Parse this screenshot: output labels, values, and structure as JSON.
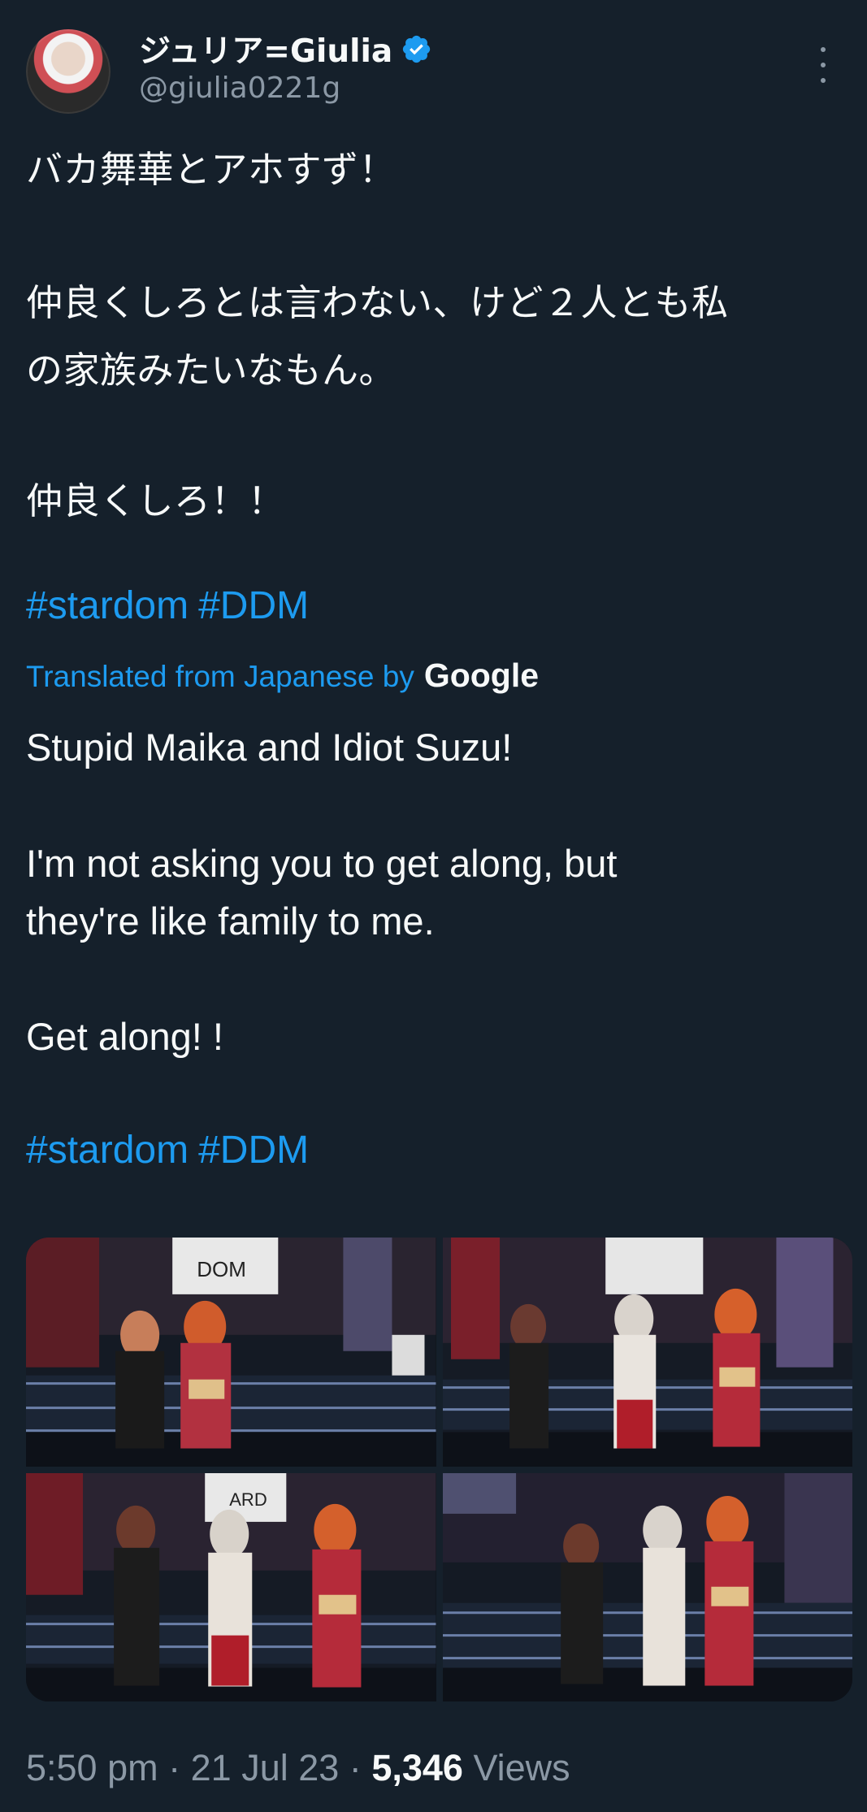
{
  "tweet": {
    "author": {
      "display_name": "ジュリア=Giulia",
      "handle": "@giulia0221g",
      "verified": true
    },
    "original_text": [
      "バカ舞華とアホすず！",
      "仲良くしろとは言わない、けど２人とも私",
      "の家族みたいなもん。",
      "仲良くしろ！！"
    ],
    "hashtags": [
      "#stardom",
      "#DDM"
    ],
    "translation": {
      "label": "Translated from Japanese by",
      "provider": "Google",
      "text": [
        "Stupid Maika and Idiot Suzu!",
        "I'm not asking you to get along, but",
        "they're like family to me.",
        "Get along! !"
      ]
    },
    "media": {
      "count": 4,
      "description": [
        "photo-1",
        "photo-2",
        "photo-3",
        "photo-4"
      ]
    },
    "meta": {
      "time": "5:50 pm",
      "date": "21 Jul 23",
      "separator": "·",
      "views_count": "5,346",
      "views_label": "Views"
    }
  },
  "colors": {
    "background": "#15202b",
    "text_primary": "#f7f9f9",
    "text_secondary": "#8b98a5",
    "accent": "#1d9bf0"
  }
}
